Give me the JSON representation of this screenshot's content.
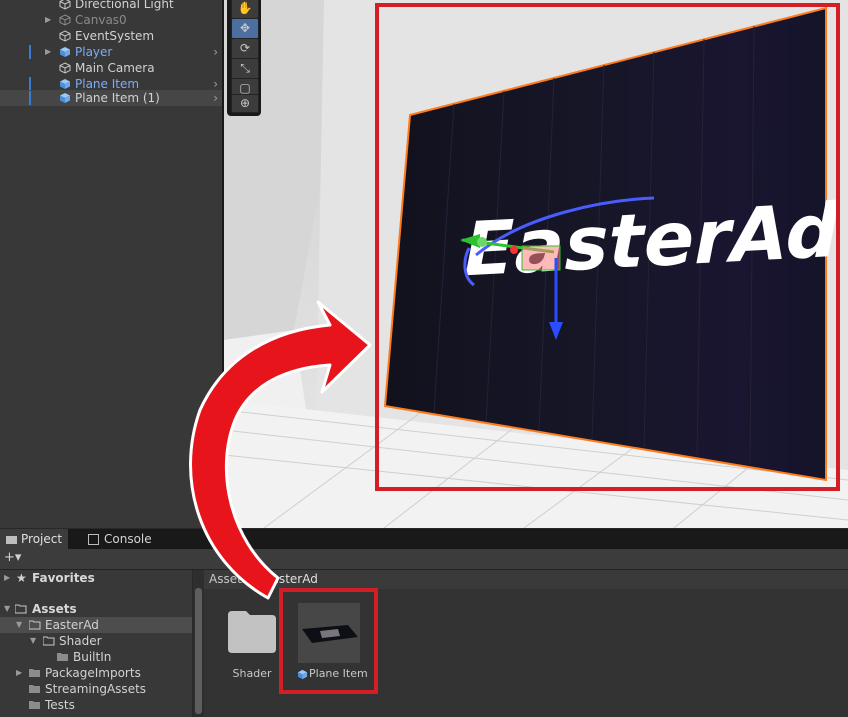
{
  "hierarchy": {
    "items": [
      {
        "label": "Directional Light",
        "style": "normal"
      },
      {
        "label": "Canvas0",
        "style": "dim"
      },
      {
        "label": "EventSystem",
        "style": "normal"
      },
      {
        "label": "Player",
        "style": "blue"
      },
      {
        "label": "Main Camera",
        "style": "normal"
      },
      {
        "label": "Plane Item",
        "style": "blue"
      },
      {
        "label": "Plane Item (1)",
        "style": "normal",
        "selected": true
      }
    ]
  },
  "scene": {
    "billboard_text": "EasterAd",
    "tools": [
      "hand-tool-icon",
      "move-tool-icon",
      "rotate-tool-icon",
      "scale-tool-icon",
      "rect-tool-icon",
      "transform-tool-icon"
    ]
  },
  "panel": {
    "tabs": [
      {
        "label": "Project",
        "icon": "folder-icon",
        "active": true
      },
      {
        "label": "Console",
        "icon": "console-icon",
        "active": false
      }
    ],
    "add_label": "+▾"
  },
  "tree": {
    "favorites": "Favorites",
    "assets": "Assets",
    "items": [
      {
        "label": "EasterAd",
        "selected": true
      },
      {
        "label": "Shader"
      },
      {
        "label": "BuiltIn"
      },
      {
        "label": "PackageImports"
      },
      {
        "label": "StreamingAssets"
      },
      {
        "label": "Tests"
      }
    ]
  },
  "breadcrumb": {
    "root": "Assets",
    "separator": "›",
    "current": "EasterAd"
  },
  "grid": {
    "items": [
      {
        "label": "Shader",
        "type": "folder"
      },
      {
        "label": "Plane Item",
        "type": "prefab"
      }
    ]
  },
  "colors": {
    "highlight": "#d21e26",
    "selection_blue": "#7cacf8",
    "panel_bg": "#383838",
    "orange_outline": "#ff7a1a"
  }
}
